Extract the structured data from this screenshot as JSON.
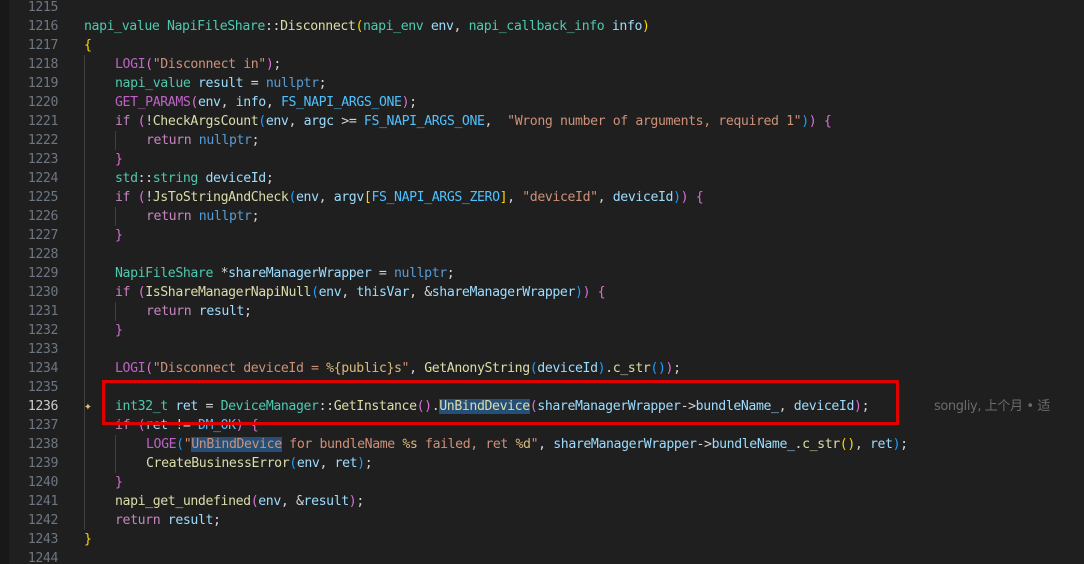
{
  "editor": {
    "highlighted_line": "1236",
    "blame_annotation": "songliy, 上个月 • 适",
    "lines": [
      {
        "num": "1215",
        "indent": 0,
        "tokens": []
      },
      {
        "num": "1216",
        "indent": 0,
        "tokens": [
          {
            "t": "napi_value",
            "c": "type"
          },
          {
            "t": " ",
            "c": "txt"
          },
          {
            "t": "NapiFileShare",
            "c": "type"
          },
          {
            "t": "::",
            "c": "op"
          },
          {
            "t": "Disconnect",
            "c": "fn"
          },
          {
            "t": "(",
            "c": "p1"
          },
          {
            "t": "napi_env",
            "c": "type"
          },
          {
            "t": " ",
            "c": "txt"
          },
          {
            "t": "env",
            "c": "var"
          },
          {
            "t": ", ",
            "c": "txt"
          },
          {
            "t": "napi_callback_info",
            "c": "type"
          },
          {
            "t": " ",
            "c": "txt"
          },
          {
            "t": "info",
            "c": "var"
          },
          {
            "t": ")",
            "c": "p1"
          }
        ]
      },
      {
        "num": "1217",
        "indent": 0,
        "tokens": [
          {
            "t": "{",
            "c": "p1"
          }
        ]
      },
      {
        "num": "1218",
        "indent": 1,
        "tokens": [
          {
            "t": "LOGI",
            "c": "macro"
          },
          {
            "t": "(",
            "c": "p2"
          },
          {
            "t": "\"Disconnect in\"",
            "c": "str"
          },
          {
            "t": ")",
            "c": "p2"
          },
          {
            "t": ";",
            "c": "txt"
          }
        ]
      },
      {
        "num": "1219",
        "indent": 1,
        "tokens": [
          {
            "t": "napi_value",
            "c": "type"
          },
          {
            "t": " ",
            "c": "txt"
          },
          {
            "t": "result",
            "c": "var"
          },
          {
            "t": " = ",
            "c": "op"
          },
          {
            "t": "nullptr",
            "c": "kw"
          },
          {
            "t": ";",
            "c": "txt"
          }
        ]
      },
      {
        "num": "1220",
        "indent": 1,
        "tokens": [
          {
            "t": "GET_PARAMS",
            "c": "macro"
          },
          {
            "t": "(",
            "c": "p2"
          },
          {
            "t": "env",
            "c": "var"
          },
          {
            "t": ", ",
            "c": "txt"
          },
          {
            "t": "info",
            "c": "var"
          },
          {
            "t": ", ",
            "c": "txt"
          },
          {
            "t": "FS_NAPI_ARGS_ONE",
            "c": "const"
          },
          {
            "t": ")",
            "c": "p2"
          },
          {
            "t": ";",
            "c": "txt"
          }
        ]
      },
      {
        "num": "1221",
        "indent": 1,
        "tokens": [
          {
            "t": "if",
            "c": "ctl"
          },
          {
            "t": " ",
            "c": "txt"
          },
          {
            "t": "(",
            "c": "p2"
          },
          {
            "t": "!",
            "c": "op"
          },
          {
            "t": "CheckArgsCount",
            "c": "fn"
          },
          {
            "t": "(",
            "c": "p3"
          },
          {
            "t": "env",
            "c": "var"
          },
          {
            "t": ", ",
            "c": "txt"
          },
          {
            "t": "argc",
            "c": "var"
          },
          {
            "t": " >= ",
            "c": "op"
          },
          {
            "t": "FS_NAPI_ARGS_ONE",
            "c": "const"
          },
          {
            "t": ",  ",
            "c": "txt"
          },
          {
            "t": "\"Wrong number of arguments, required 1\"",
            "c": "str"
          },
          {
            "t": ")",
            "c": "p3"
          },
          {
            "t": ")",
            "c": "p2"
          },
          {
            "t": " ",
            "c": "txt"
          },
          {
            "t": "{",
            "c": "p2"
          }
        ]
      },
      {
        "num": "1222",
        "indent": 2,
        "tokens": [
          {
            "t": "return",
            "c": "ctl"
          },
          {
            "t": " ",
            "c": "txt"
          },
          {
            "t": "nullptr",
            "c": "kw"
          },
          {
            "t": ";",
            "c": "txt"
          }
        ]
      },
      {
        "num": "1223",
        "indent": 1,
        "tokens": [
          {
            "t": "}",
            "c": "p2"
          }
        ]
      },
      {
        "num": "1224",
        "indent": 1,
        "tokens": [
          {
            "t": "std",
            "c": "type"
          },
          {
            "t": "::",
            "c": "op"
          },
          {
            "t": "string",
            "c": "type"
          },
          {
            "t": " ",
            "c": "txt"
          },
          {
            "t": "deviceId",
            "c": "var"
          },
          {
            "t": ";",
            "c": "txt"
          }
        ]
      },
      {
        "num": "1225",
        "indent": 1,
        "tokens": [
          {
            "t": "if",
            "c": "ctl"
          },
          {
            "t": " ",
            "c": "txt"
          },
          {
            "t": "(",
            "c": "p2"
          },
          {
            "t": "!",
            "c": "op"
          },
          {
            "t": "JsToStringAndCheck",
            "c": "fn"
          },
          {
            "t": "(",
            "c": "p3"
          },
          {
            "t": "env",
            "c": "var"
          },
          {
            "t": ", ",
            "c": "txt"
          },
          {
            "t": "argv",
            "c": "var"
          },
          {
            "t": "[",
            "c": "p1"
          },
          {
            "t": "FS_NAPI_ARGS_ZERO",
            "c": "const"
          },
          {
            "t": "]",
            "c": "p1"
          },
          {
            "t": ", ",
            "c": "txt"
          },
          {
            "t": "\"deviceId\"",
            "c": "str"
          },
          {
            "t": ", ",
            "c": "txt"
          },
          {
            "t": "deviceId",
            "c": "var"
          },
          {
            "t": ")",
            "c": "p3"
          },
          {
            "t": ")",
            "c": "p2"
          },
          {
            "t": " ",
            "c": "txt"
          },
          {
            "t": "{",
            "c": "p2"
          }
        ]
      },
      {
        "num": "1226",
        "indent": 2,
        "tokens": [
          {
            "t": "return",
            "c": "ctl"
          },
          {
            "t": " ",
            "c": "txt"
          },
          {
            "t": "nullptr",
            "c": "kw"
          },
          {
            "t": ";",
            "c": "txt"
          }
        ]
      },
      {
        "num": "1227",
        "indent": 1,
        "tokens": [
          {
            "t": "}",
            "c": "p2"
          }
        ]
      },
      {
        "num": "1228",
        "indent": 1,
        "tokens": []
      },
      {
        "num": "1229",
        "indent": 1,
        "tokens": [
          {
            "t": "NapiFileShare",
            "c": "type"
          },
          {
            "t": " ",
            "c": "txt"
          },
          {
            "t": "*",
            "c": "op"
          },
          {
            "t": "shareManagerWrapper",
            "c": "var"
          },
          {
            "t": " = ",
            "c": "op"
          },
          {
            "t": "nullptr",
            "c": "kw"
          },
          {
            "t": ";",
            "c": "txt"
          }
        ]
      },
      {
        "num": "1230",
        "indent": 1,
        "tokens": [
          {
            "t": "if",
            "c": "ctl"
          },
          {
            "t": " ",
            "c": "txt"
          },
          {
            "t": "(",
            "c": "p2"
          },
          {
            "t": "IsShareManagerNapiNull",
            "c": "fn"
          },
          {
            "t": "(",
            "c": "p3"
          },
          {
            "t": "env",
            "c": "var"
          },
          {
            "t": ", ",
            "c": "txt"
          },
          {
            "t": "thisVar",
            "c": "var"
          },
          {
            "t": ", ",
            "c": "txt"
          },
          {
            "t": "&",
            "c": "op"
          },
          {
            "t": "shareManagerWrapper",
            "c": "var"
          },
          {
            "t": ")",
            "c": "p3"
          },
          {
            "t": ")",
            "c": "p2"
          },
          {
            "t": " ",
            "c": "txt"
          },
          {
            "t": "{",
            "c": "p2"
          }
        ]
      },
      {
        "num": "1231",
        "indent": 2,
        "tokens": [
          {
            "t": "return",
            "c": "ctl"
          },
          {
            "t": " ",
            "c": "txt"
          },
          {
            "t": "result",
            "c": "var"
          },
          {
            "t": ";",
            "c": "txt"
          }
        ]
      },
      {
        "num": "1232",
        "indent": 1,
        "tokens": [
          {
            "t": "}",
            "c": "p2"
          }
        ]
      },
      {
        "num": "1233",
        "indent": 1,
        "tokens": []
      },
      {
        "num": "1234",
        "indent": 1,
        "tokens": [
          {
            "t": "LOGI",
            "c": "macro"
          },
          {
            "t": "(",
            "c": "p2"
          },
          {
            "t": "\"Disconnect deviceId = ",
            "c": "str"
          },
          {
            "t": "%{public}s",
            "c": "esc"
          },
          {
            "t": "\"",
            "c": "str"
          },
          {
            "t": ", ",
            "c": "txt"
          },
          {
            "t": "GetAnonyString",
            "c": "fn"
          },
          {
            "t": "(",
            "c": "p3"
          },
          {
            "t": "deviceId",
            "c": "var"
          },
          {
            "t": ")",
            "c": "p3"
          },
          {
            "t": ".",
            "c": "txt"
          },
          {
            "t": "c_str",
            "c": "fn"
          },
          {
            "t": "(",
            "c": "p3"
          },
          {
            "t": ")",
            "c": "p3"
          },
          {
            "t": ")",
            "c": "p2"
          },
          {
            "t": ";",
            "c": "txt"
          }
        ]
      },
      {
        "num": "1235",
        "indent": 1,
        "tokens": []
      },
      {
        "num": "1236",
        "indent": 1,
        "sparkle": true,
        "tokens": [
          {
            "t": "int32_t",
            "c": "type"
          },
          {
            "t": " ",
            "c": "txt"
          },
          {
            "t": "ret",
            "c": "var"
          },
          {
            "t": " = ",
            "c": "op"
          },
          {
            "t": "DeviceManager",
            "c": "type"
          },
          {
            "t": "::",
            "c": "op"
          },
          {
            "t": "GetInstance",
            "c": "fn"
          },
          {
            "t": "(",
            "c": "p2"
          },
          {
            "t": ")",
            "c": "p2"
          },
          {
            "t": ".",
            "c": "txt"
          },
          {
            "t": "UnBindDevice",
            "c": "fn",
            "sel": true
          },
          {
            "t": "(",
            "c": "p2"
          },
          {
            "t": "shareManagerWrapper",
            "c": "var"
          },
          {
            "t": "->",
            "c": "op"
          },
          {
            "t": "bundleName_",
            "c": "var"
          },
          {
            "t": ", ",
            "c": "txt"
          },
          {
            "t": "deviceId",
            "c": "var"
          },
          {
            "t": ")",
            "c": "p2"
          },
          {
            "t": ";",
            "c": "txt"
          }
        ]
      },
      {
        "num": "1237",
        "indent": 1,
        "tokens": [
          {
            "t": "if",
            "c": "ctl"
          },
          {
            "t": " ",
            "c": "txt"
          },
          {
            "t": "(",
            "c": "p2"
          },
          {
            "t": "ret",
            "c": "var"
          },
          {
            "t": " != ",
            "c": "op"
          },
          {
            "t": "DM_OK",
            "c": "const"
          },
          {
            "t": ")",
            "c": "p2"
          },
          {
            "t": " ",
            "c": "txt"
          },
          {
            "t": "{",
            "c": "p2"
          }
        ]
      },
      {
        "num": "1238",
        "indent": 2,
        "tokens": [
          {
            "t": "LOGE",
            "c": "macro"
          },
          {
            "t": "(",
            "c": "p3"
          },
          {
            "t": "\"",
            "c": "str"
          },
          {
            "t": "UnBindDevice",
            "c": "str",
            "sel": true
          },
          {
            "t": " for bundleName ",
            "c": "str"
          },
          {
            "t": "%s",
            "c": "esc"
          },
          {
            "t": " failed, ret ",
            "c": "str"
          },
          {
            "t": "%d",
            "c": "esc"
          },
          {
            "t": "\"",
            "c": "str"
          },
          {
            "t": ", ",
            "c": "txt"
          },
          {
            "t": "shareManagerWrapper",
            "c": "var"
          },
          {
            "t": "->",
            "c": "op"
          },
          {
            "t": "bundleName_",
            "c": "var"
          },
          {
            "t": ".",
            "c": "txt"
          },
          {
            "t": "c_str",
            "c": "fn"
          },
          {
            "t": "(",
            "c": "p1"
          },
          {
            "t": ")",
            "c": "p1"
          },
          {
            "t": ", ",
            "c": "txt"
          },
          {
            "t": "ret",
            "c": "var"
          },
          {
            "t": ")",
            "c": "p3"
          },
          {
            "t": ";",
            "c": "txt"
          }
        ]
      },
      {
        "num": "1239",
        "indent": 2,
        "tokens": [
          {
            "t": "CreateBusinessError",
            "c": "fn"
          },
          {
            "t": "(",
            "c": "p3"
          },
          {
            "t": "env",
            "c": "var"
          },
          {
            "t": ", ",
            "c": "txt"
          },
          {
            "t": "ret",
            "c": "var"
          },
          {
            "t": ")",
            "c": "p3"
          },
          {
            "t": ";",
            "c": "txt"
          }
        ]
      },
      {
        "num": "1240",
        "indent": 1,
        "tokens": [
          {
            "t": "}",
            "c": "p2"
          }
        ]
      },
      {
        "num": "1241",
        "indent": 1,
        "tokens": [
          {
            "t": "napi_get_undefined",
            "c": "fn"
          },
          {
            "t": "(",
            "c": "p2"
          },
          {
            "t": "env",
            "c": "var"
          },
          {
            "t": ", ",
            "c": "txt"
          },
          {
            "t": "&",
            "c": "op"
          },
          {
            "t": "result",
            "c": "var"
          },
          {
            "t": ")",
            "c": "p2"
          },
          {
            "t": ";",
            "c": "txt"
          }
        ]
      },
      {
        "num": "1242",
        "indent": 1,
        "tokens": [
          {
            "t": "return",
            "c": "ctl"
          },
          {
            "t": " ",
            "c": "txt"
          },
          {
            "t": "result",
            "c": "var"
          },
          {
            "t": ";",
            "c": "txt"
          }
        ]
      },
      {
        "num": "1243",
        "indent": 0,
        "tokens": [
          {
            "t": "}",
            "c": "p1"
          }
        ]
      },
      {
        "num": "1244",
        "indent": 0,
        "tokens": []
      }
    ]
  }
}
